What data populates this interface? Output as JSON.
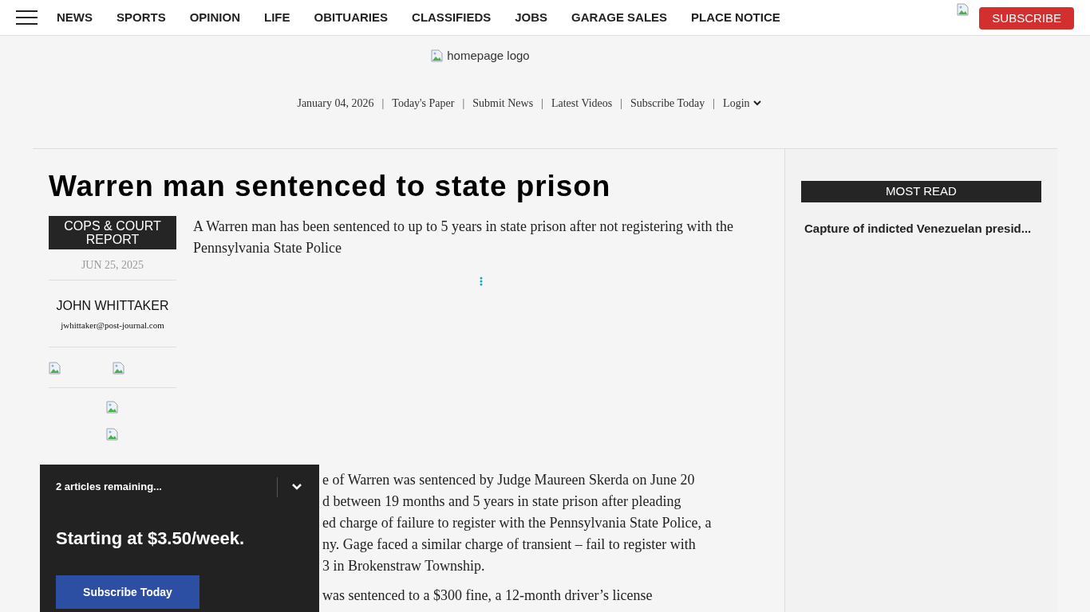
{
  "nav": {
    "items": [
      "NEWS",
      "SPORTS",
      "OPINION",
      "LIFE",
      "OBITUARIES",
      "CLASSIFIEDS",
      "JOBS",
      "GARAGE SALES",
      "PLACE NOTICE"
    ],
    "subscribe": "SUBSCRIBE"
  },
  "masthead": {
    "logo_alt": "homepage logo",
    "date": "January 04, 2026",
    "links": [
      "Today's Paper",
      "Submit News",
      "Latest Videos",
      "Subscribe Today"
    ],
    "login": "Login",
    "separator": "|"
  },
  "article": {
    "title": "Warren man sentenced to state prison",
    "section": "COPS & COURT REPORT",
    "date": "JUN 25, 2025",
    "author": "JOHN WHITTAKER",
    "email": "jwhittaker@post-journal.com",
    "summary": "A Warren man has been sentenced to up to 5 years in state prison after not registering with the Pennsylvania State Police",
    "body": [
      {
        "lines": [
          "e of Warren was sentenced by Judge Maureen Skerda on June 20",
          "d between 19 months and 5 years in state prison after pleading",
          "ed charge of failure to register with the Pennsylvania State Police, a",
          "ny. Gage faced a similar charge of transient – fail to register with",
          "3 in Brokenstraw Township."
        ]
      },
      {
        "lines": [
          "was sentenced to a $300 fine, a 12-month driver’s license"
        ]
      }
    ]
  },
  "sidebar": {
    "heading": "MOST READ",
    "items": [
      "Capture of indicted Venezuelan presid..."
    ]
  },
  "paywall": {
    "remaining": "2 articles remaining...",
    "expanded": true,
    "offer": "Starting at $3.50/week.",
    "button": "Subscribe Today"
  }
}
